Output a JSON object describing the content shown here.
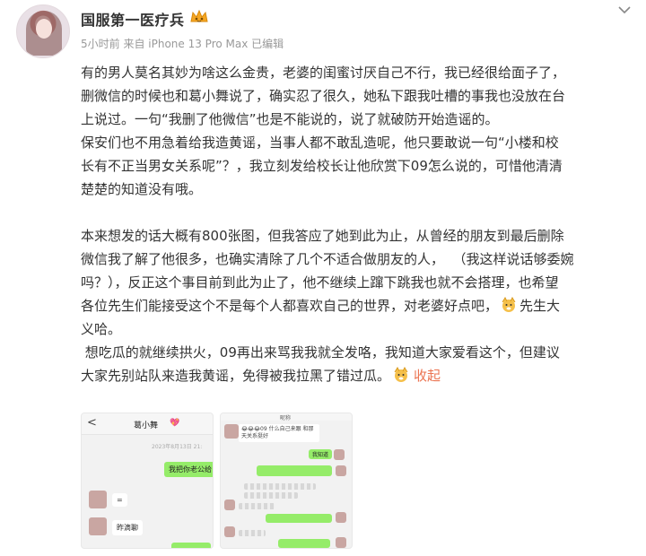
{
  "header": {
    "username": "国服第一医疗兵",
    "meta": "5小时前 来自 iPhone 13 Pro Max 已编辑",
    "vip_icon": "crown-icon",
    "menu_icon": "chevron-down-icon"
  },
  "post": {
    "lines": [
      "有的男人莫名其妙为啥这么金贵，老婆的闺蜜讨厌自己不行，我已经很给面子了，",
      "删微信的时候也和葛小舞说了，确实忍了很久，她私下跟我吐槽的事我也没放在台",
      "上说过。一句“我删了他微信”也是不能说的，说了就破防开始造谣的。",
      "保安们也不用急着给我造黄谣，当事人都不敢乱造呢，他只要敢说一句“小楼和校",
      "长有不正当男女关系呢”？，我立刻发给校长让他欣赏下09怎么说的，可惜他清清",
      "楚楚的知道没有哦。",
      "",
      "本来想发的话大概有800张图，但我答应了她到此为止，从曾经的朋友到最后删除",
      "微信我了解了他很多，也确实清除了几个不适合做朋友的人，  （我这样说话够委婉",
      "吗？），反正这个事目前到此为止了，他不继续上蹿下跳我也就不会搭理，也希望",
      "各位先生们能接受这个不是每个人都喜欢自己的世界，对老婆好点吧，",
      "义哈。",
      " 想吃瓜的就继续拱火，09再出来骂我我就全发咯，我知道大家爱看这个，但建议",
      "大家先别站队来造我黄谣，免得被我拉黑了错过瓜。"
    ],
    "line11_tail": "先生大",
    "collapse": "收起",
    "emoji_icon": "doge-emoji-icon"
  },
  "images": {
    "shot1": {
      "back": "<",
      "contact": "葛小舞",
      "heart": "💖",
      "timestamp": "2023年8月13日 21:",
      "msg1": "我把你老公给",
      "msg2": "=",
      "msg3": "昨滴聊"
    },
    "shot2": {
      "title": "昵称",
      "quote": "😂😂😂09 什么自己来跟 和那天关系挺好",
      "msg1": "我知道"
    }
  },
  "colors": {
    "link": "#eb7350",
    "chat_green": "#95ec69",
    "meta_gray": "#999999"
  }
}
